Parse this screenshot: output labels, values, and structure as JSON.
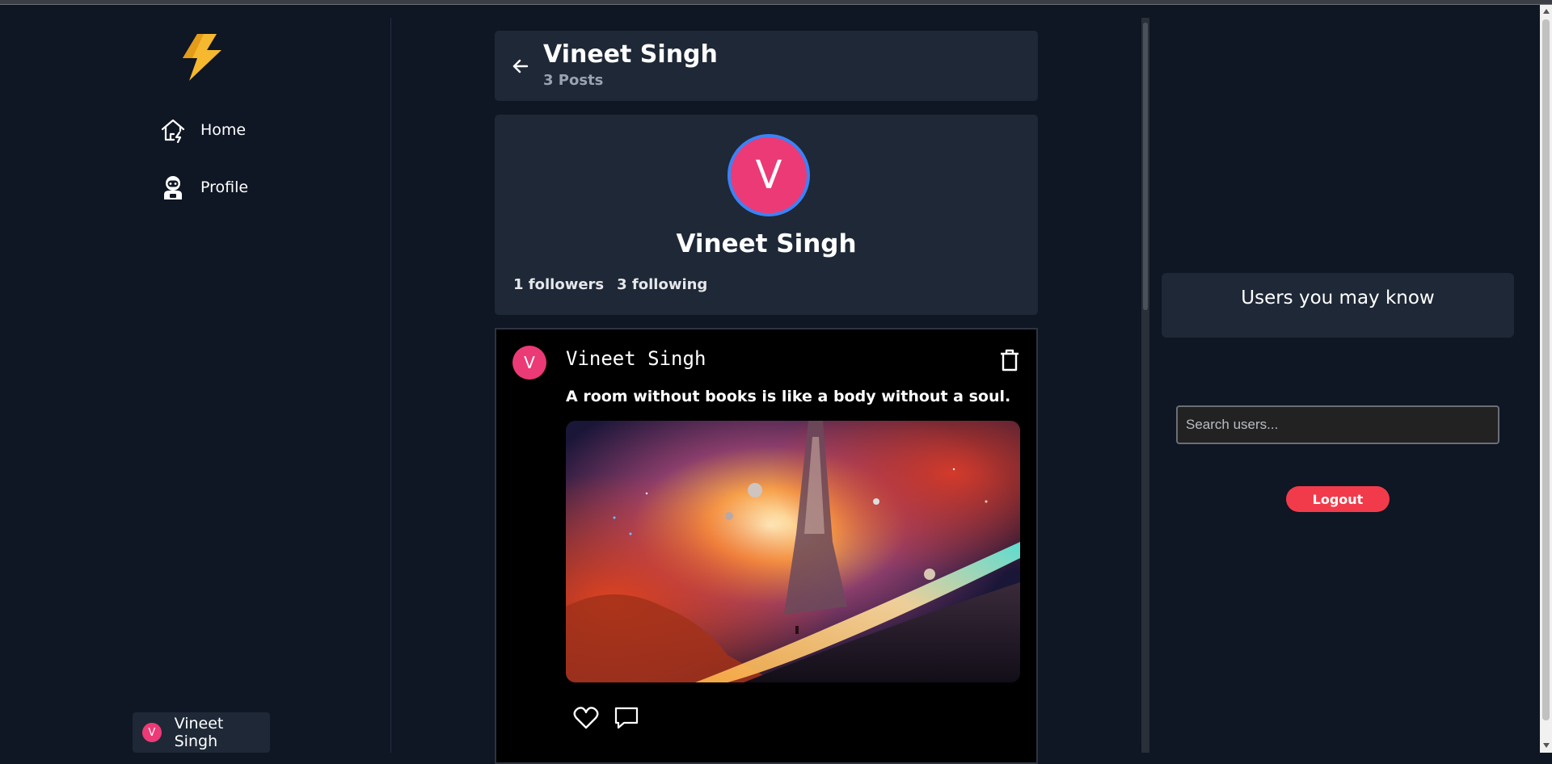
{
  "nav": {
    "home_label": "Home",
    "profile_label": "Profile"
  },
  "current_user": {
    "name": "Vineet Singh",
    "avatar_letter": "V"
  },
  "header": {
    "name": "Vineet Singh",
    "posts_count": "3 Posts"
  },
  "profile": {
    "avatar_letter": "V",
    "name": "Vineet Singh",
    "followers": "1 followers",
    "following": "3 following"
  },
  "post": {
    "avatar_letter": "V",
    "author": "Vineet Singh",
    "text": "A room without books is like a body without a soul."
  },
  "right_panel": {
    "suggest_title": "Users you may know",
    "search_placeholder": "Search users...",
    "logout_label": "Logout"
  },
  "colors": {
    "background": "#0f1624",
    "card": "#1e2836",
    "avatar": "#ec3a76",
    "avatar_ring": "#3b82f6",
    "logout": "#f23b4a",
    "logo": "#f5b82e"
  },
  "icons": [
    "lightning-logo-icon",
    "home-icon",
    "astronaut-icon",
    "back-arrow-icon",
    "trash-icon",
    "heart-icon",
    "comment-icon"
  ]
}
